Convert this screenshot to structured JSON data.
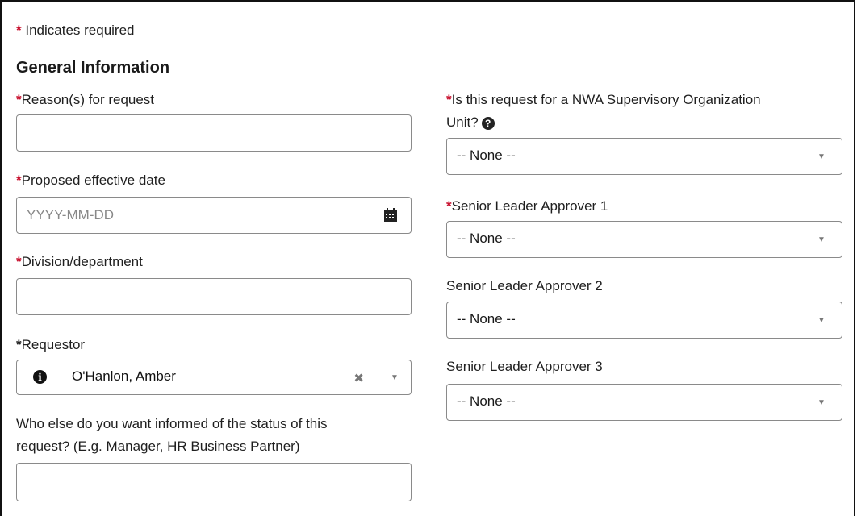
{
  "legend": {
    "star": "*",
    "text": "Indicates required"
  },
  "section_title": "General Information",
  "left": {
    "reason": {
      "label": "Reason(s) for request",
      "value": ""
    },
    "effective_date": {
      "label": "Proposed effective date",
      "placeholder": "YYYY-MM-DD"
    },
    "division": {
      "label": "Division/department",
      "value": ""
    },
    "requestor": {
      "label": "Requestor",
      "value": "O'Hanlon, Amber"
    },
    "informed": {
      "label_line1": "Who else do you want informed of the status of this",
      "label_line2": "request? (E.g. Manager, HR Business Partner)",
      "value": ""
    }
  },
  "right": {
    "nwa": {
      "label_line1": "Is this request for a NWA Supervisory Organization",
      "label_line2": "Unit?",
      "value": "-- None --"
    },
    "approver1": {
      "label": "Senior Leader Approver 1",
      "value": "-- None --"
    },
    "approver2": {
      "label": "Senior Leader Approver 2",
      "value": "-- None --"
    },
    "approver3": {
      "label": "Senior Leader Approver 3",
      "value": "-- None --"
    }
  },
  "icons": {
    "calendar": "calendar-icon",
    "help": "question-circle-icon",
    "info": "info-circle-icon",
    "clear": "clear-x-icon",
    "dropdown": "chevron-down-icon"
  },
  "colors": {
    "required": "#c8102e",
    "border": "#8a8a8a"
  }
}
